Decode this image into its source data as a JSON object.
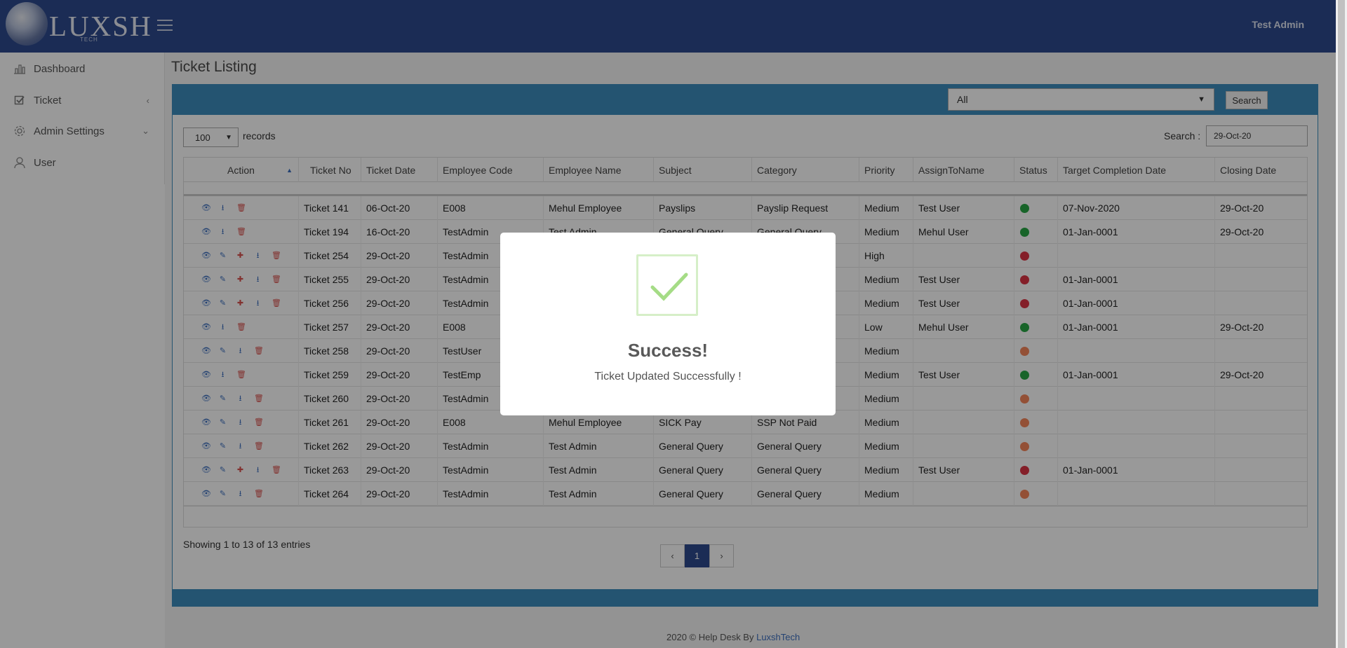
{
  "header": {
    "logo_text": "LUXSH",
    "logo_sub": "TECH",
    "user_name": "Test Admin"
  },
  "sidebar": {
    "items": [
      {
        "label": "Dashboard",
        "icon": "bar-chart-icon"
      },
      {
        "label": "Ticket",
        "icon": "checkbox-icon"
      },
      {
        "label": "Admin Settings",
        "icon": "gear-icon"
      },
      {
        "label": "User",
        "icon": "user-icon"
      }
    ]
  },
  "page": {
    "title": "Ticket Listing"
  },
  "filter": {
    "selected": "All",
    "search_button": "Search"
  },
  "controls": {
    "page_length": "100",
    "records_label": "records",
    "search_label": "Search :",
    "search_value": "29-Oct-20"
  },
  "table": {
    "columns": [
      "Action",
      "Ticket No",
      "Ticket Date",
      "Employee Code",
      "Employee Name",
      "Subject",
      "Category",
      "Priority",
      "AssignToName",
      "Status",
      "Target Completion Date",
      "Closing Date"
    ],
    "rows": [
      {
        "no": "Ticket 141",
        "date": "06-Oct-20",
        "code": "E008",
        "name": "Mehul Employee",
        "subject": "Payslips",
        "category": "Payslip Request",
        "priority": "Medium",
        "assign": "Test User",
        "status": "green",
        "target": "07-Nov-2020",
        "closing": "29-Oct-20",
        "actions": "view,download,delete"
      },
      {
        "no": "Ticket 194",
        "date": "16-Oct-20",
        "code": "TestAdmin",
        "name": "Test Admin",
        "subject": "General Query",
        "category": "General Query",
        "priority": "Medium",
        "assign": "Mehul User",
        "status": "green",
        "target": "01-Jan-0001",
        "closing": "29-Oct-20",
        "actions": "view,download,delete"
      },
      {
        "no": "Ticket 254",
        "date": "29-Oct-20",
        "code": "TestAdmin",
        "name": "",
        "subject": "",
        "category": "",
        "priority": "High",
        "assign": "",
        "status": "red",
        "target": "",
        "closing": "",
        "actions": "view,edit,assign,download,delete"
      },
      {
        "no": "Ticket 255",
        "date": "29-Oct-20",
        "code": "TestAdmin",
        "name": "",
        "subject": "",
        "category": "",
        "priority": "Medium",
        "assign": "Test User",
        "status": "red",
        "target": "01-Jan-0001",
        "closing": "",
        "actions": "view,edit,assign,download,delete"
      },
      {
        "no": "Ticket 256",
        "date": "29-Oct-20",
        "code": "TestAdmin",
        "name": "",
        "subject": "",
        "category": "",
        "priority": "Medium",
        "assign": "Test User",
        "status": "red",
        "target": "01-Jan-0001",
        "closing": "",
        "actions": "view,edit,assign,download,delete"
      },
      {
        "no": "Ticket 257",
        "date": "29-Oct-20",
        "code": "E008",
        "name": "",
        "subject": "",
        "category": "",
        "priority": "Low",
        "assign": "Mehul User",
        "status": "green",
        "target": "01-Jan-0001",
        "closing": "29-Oct-20",
        "actions": "view,download,delete"
      },
      {
        "no": "Ticket 258",
        "date": "29-Oct-20",
        "code": "TestUser",
        "name": "",
        "subject": "",
        "category": "",
        "priority": "Medium",
        "assign": "",
        "status": "orange",
        "target": "",
        "closing": "",
        "actions": "view,edit,download,delete"
      },
      {
        "no": "Ticket 259",
        "date": "29-Oct-20",
        "code": "TestEmp",
        "name": "",
        "subject": "",
        "category": "",
        "priority": "Medium",
        "assign": "Test User",
        "status": "green",
        "target": "01-Jan-0001",
        "closing": "29-Oct-20",
        "actions": "view,download,delete"
      },
      {
        "no": "Ticket 260",
        "date": "29-Oct-20",
        "code": "TestAdmin",
        "name": "",
        "subject": "",
        "category": "",
        "priority": "Medium",
        "assign": "",
        "status": "orange",
        "target": "",
        "closing": "",
        "actions": "view,edit,download,delete"
      },
      {
        "no": "Ticket 261",
        "date": "29-Oct-20",
        "code": "E008",
        "name": "Mehul Employee",
        "subject": "SICK Pay",
        "category": "SSP Not Paid",
        "priority": "Medium",
        "assign": "",
        "status": "orange",
        "target": "",
        "closing": "",
        "actions": "view,edit,download,delete"
      },
      {
        "no": "Ticket 262",
        "date": "29-Oct-20",
        "code": "TestAdmin",
        "name": "Test Admin",
        "subject": "General Query",
        "category": "General Query",
        "priority": "Medium",
        "assign": "",
        "status": "orange",
        "target": "",
        "closing": "",
        "actions": "view,edit,download,delete"
      },
      {
        "no": "Ticket 263",
        "date": "29-Oct-20",
        "code": "TestAdmin",
        "name": "Test Admin",
        "subject": "General Query",
        "category": "General Query",
        "priority": "Medium",
        "assign": "Test User",
        "status": "red",
        "target": "01-Jan-0001",
        "closing": "",
        "actions": "view,edit,assign,download,delete"
      },
      {
        "no": "Ticket 264",
        "date": "29-Oct-20",
        "code": "TestAdmin",
        "name": "Test Admin",
        "subject": "General Query",
        "category": "General Query",
        "priority": "Medium",
        "assign": "",
        "status": "orange",
        "target": "",
        "closing": "",
        "actions": "view,edit,download,delete"
      }
    ]
  },
  "status_colors": {
    "green": "#28a745",
    "red": "#dc3545",
    "orange": "#f5865a"
  },
  "info": "Showing 1 to 13 of 13 entries",
  "pagination": {
    "prev": "‹",
    "current": "1",
    "next": "›"
  },
  "footer": {
    "text": "2020 © Help Desk By ",
    "brand": "LuxshTech"
  },
  "modal": {
    "title": "Success!",
    "message": "Ticket Updated Successfully !"
  }
}
